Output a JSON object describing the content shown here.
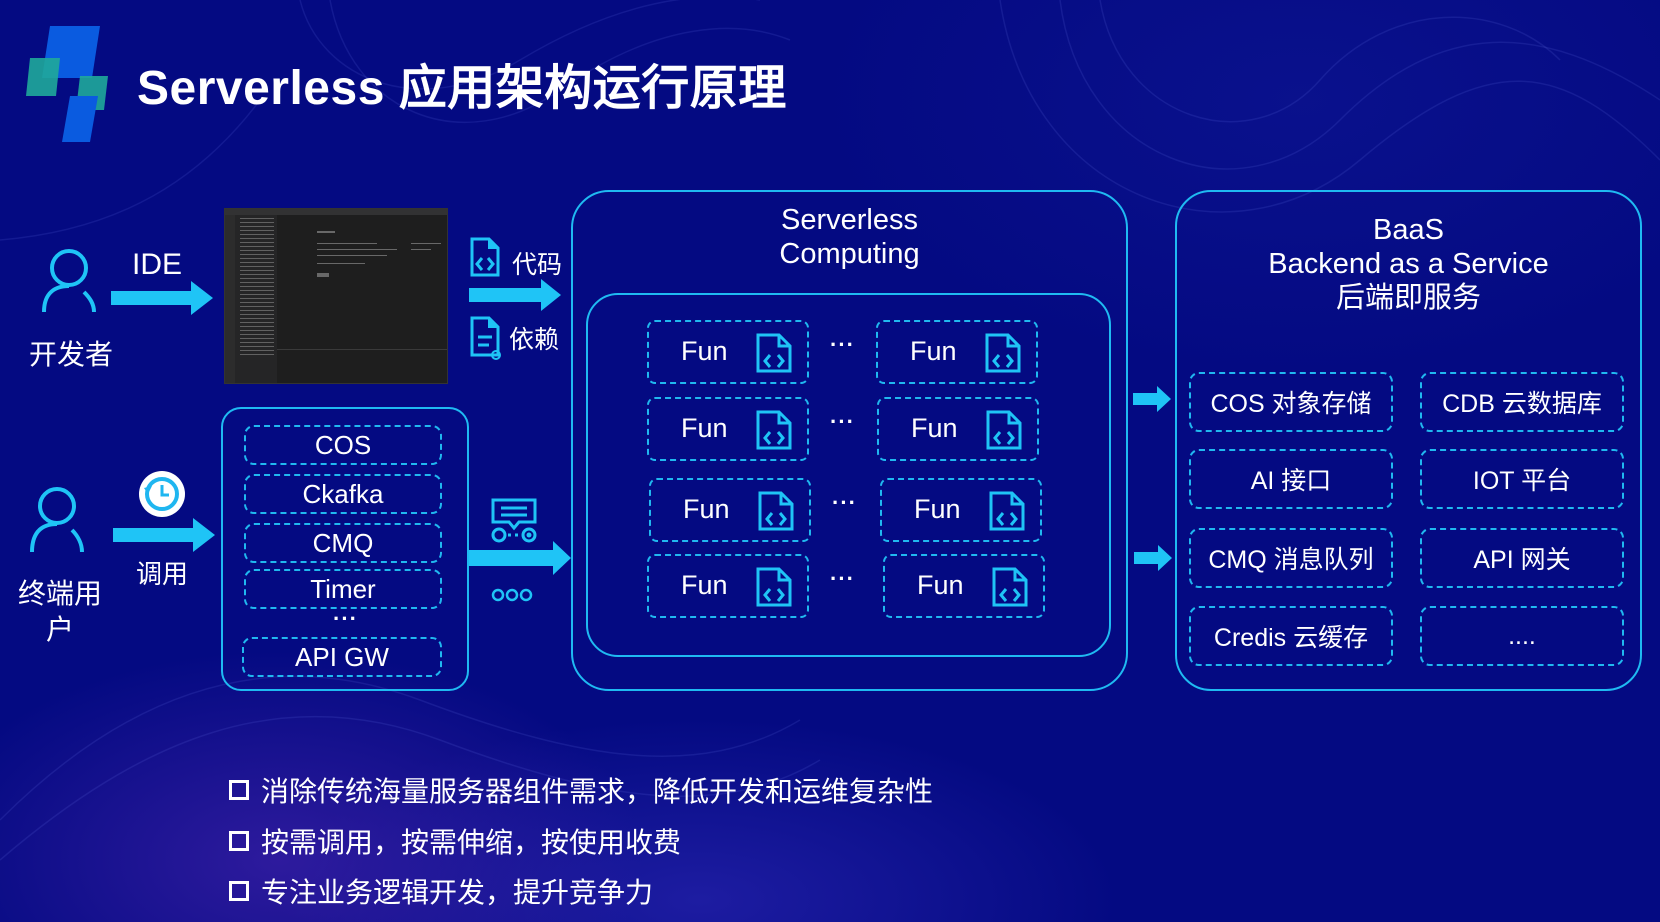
{
  "title": "Serverless 应用架构运行原理",
  "colors": {
    "background": "#040a82",
    "accent": "#1fbaf2",
    "text": "#ffffff"
  },
  "left": {
    "developer_label": "开发者",
    "ide_label": "IDE",
    "end_user_label": "终端用户",
    "invoke_label": "调用",
    "code_label": "代码",
    "deps_label": "依赖"
  },
  "triggers": {
    "items": [
      "COS",
      "Ckafka",
      "CMQ",
      "Timer"
    ],
    "ellipsis": "···",
    "last": "API GW"
  },
  "compute": {
    "title_line1": "Serverless",
    "title_line2": "Computing",
    "function_label": "Fun",
    "ellipsis": "···",
    "rows": 4
  },
  "baas": {
    "title_line1": "BaaS",
    "title_line2": "Backend as a Service",
    "title_line3": "后端即服务",
    "items": [
      "COS 对象存储",
      "CDB 云数据库",
      "AI 接口",
      "IOT 平台",
      "CMQ 消息队列",
      "API 网关",
      "Credis 云缓存",
      "...."
    ]
  },
  "bullets": [
    "消除传统海量服务器组件需求，降低开发和运维复杂性",
    "按需调用，按需伸缩，按使用收费",
    "专注业务逻辑开发，提升竞争力"
  ]
}
